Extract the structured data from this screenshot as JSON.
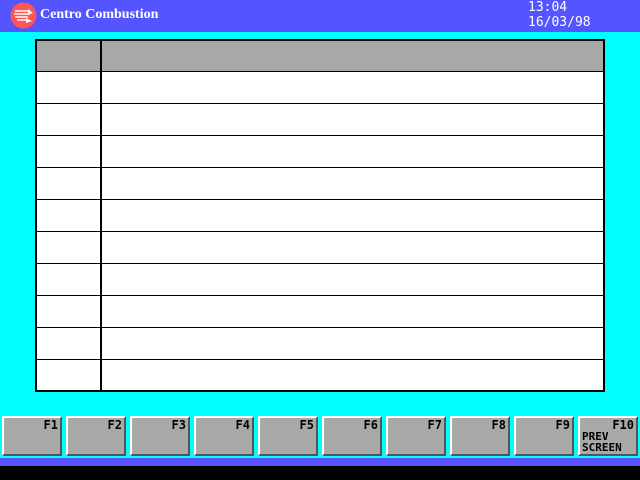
{
  "app": {
    "title": "Centro Combustion",
    "time": "13:04",
    "date": "16/03/98"
  },
  "table": {
    "headers": [
      "",
      ""
    ],
    "rows": [
      [
        "",
        ""
      ],
      [
        "",
        ""
      ],
      [
        "",
        ""
      ],
      [
        "",
        ""
      ],
      [
        "",
        ""
      ],
      [
        "",
        ""
      ],
      [
        "",
        ""
      ],
      [
        "",
        ""
      ],
      [
        "",
        ""
      ],
      [
        "",
        ""
      ]
    ]
  },
  "function_keys": [
    {
      "key": "F1",
      "label": ""
    },
    {
      "key": "F2",
      "label": ""
    },
    {
      "key": "F3",
      "label": ""
    },
    {
      "key": "F4",
      "label": ""
    },
    {
      "key": "F5",
      "label": ""
    },
    {
      "key": "F6",
      "label": ""
    },
    {
      "key": "F7",
      "label": ""
    },
    {
      "key": "F8",
      "label": ""
    },
    {
      "key": "F9",
      "label": ""
    },
    {
      "key": "F10",
      "label": "PREV\nSCREEN"
    }
  ],
  "colors": {
    "background": "#00ffff",
    "title_bar": "#5555ff",
    "header_gray": "#a8a8a8",
    "logo_red": "#ff5555"
  },
  "icons": {
    "logo": "flame-logo-icon"
  }
}
